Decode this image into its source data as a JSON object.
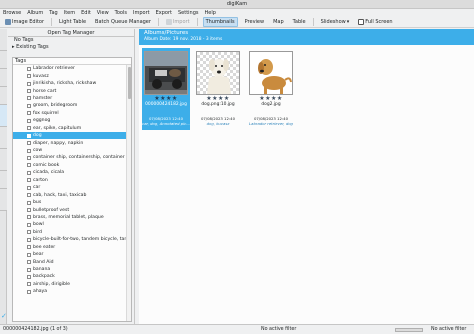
{
  "window": {
    "title": "digiKam"
  },
  "menu": [
    "Browse",
    "Album",
    "Tag",
    "Item",
    "Edit",
    "View",
    "Tools",
    "Import",
    "Export",
    "Settings",
    "Help"
  ],
  "toolbar": {
    "image_editor": "Image Editor",
    "light_table": "Light Table",
    "batch_queue": "Batch Queue Manager",
    "import": "Import",
    "thumbnails": "Thumbnails",
    "preview": "Preview",
    "map": "Map",
    "table": "Table",
    "slideshow": "Slideshow",
    "full_screen": "Full Screen"
  },
  "left_panel": {
    "header": "Open Tag Manager",
    "no_tags": "No Tags",
    "existing_tags": "Existing Tags",
    "tags_header": "Tags",
    "tags": [
      "Labrador retriever",
      "kuvasz",
      "jinrikisha, ricksha, rickshaw",
      "horse cart",
      "hamster",
      "groom, bridegroom",
      "fox squirrel",
      "eggnog",
      "ear, spike, capitulum",
      "dog",
      "diaper, nappy, napkin",
      "cow",
      "container ship, containership, container vessel",
      "comic book",
      "cicada, cicala",
      "carton",
      "car",
      "cab, hack, taxi, taxicab",
      "bus",
      "bulletproof vest",
      "brass, memorial tablet, plaque",
      "bowl",
      "bird",
      "bicycle-built-for-two, tandem bicycle, tandem",
      "bee eater",
      "bear",
      "Band Aid",
      "banana",
      "backpack",
      "airship, dirigible",
      "ahaya"
    ],
    "selected_index": 9
  },
  "album": {
    "title": "Albums/Pictures",
    "subtitle": "Album Date: 19 nov. 2018 - 3 items"
  },
  "items": [
    {
      "name": "000000424182.jpg",
      "stars": "★★★★",
      "date": "07/08/2023 12:40",
      "tags": "car, dog, Annotated pic...",
      "selected": true
    },
    {
      "name": "dog.png:10.jpg",
      "stars": "★★★★",
      "date": "07/08/2023 12:40",
      "tags": "dog, kuvasz",
      "selected": false
    },
    {
      "name": "dog2.jpg",
      "stars": "★★★★",
      "date": "07/08/2023 12:40",
      "tags": "Labrador retriever, dog",
      "selected": false
    }
  ],
  "status": {
    "left": "000000424182.jpg (1 of 3)",
    "filter_mid": "No active filter",
    "filter_right": "No active filter"
  },
  "colors": {
    "accent": "#3daee9",
    "window_bg": "#eff0f1",
    "view_bg": "#fcfcfc"
  }
}
